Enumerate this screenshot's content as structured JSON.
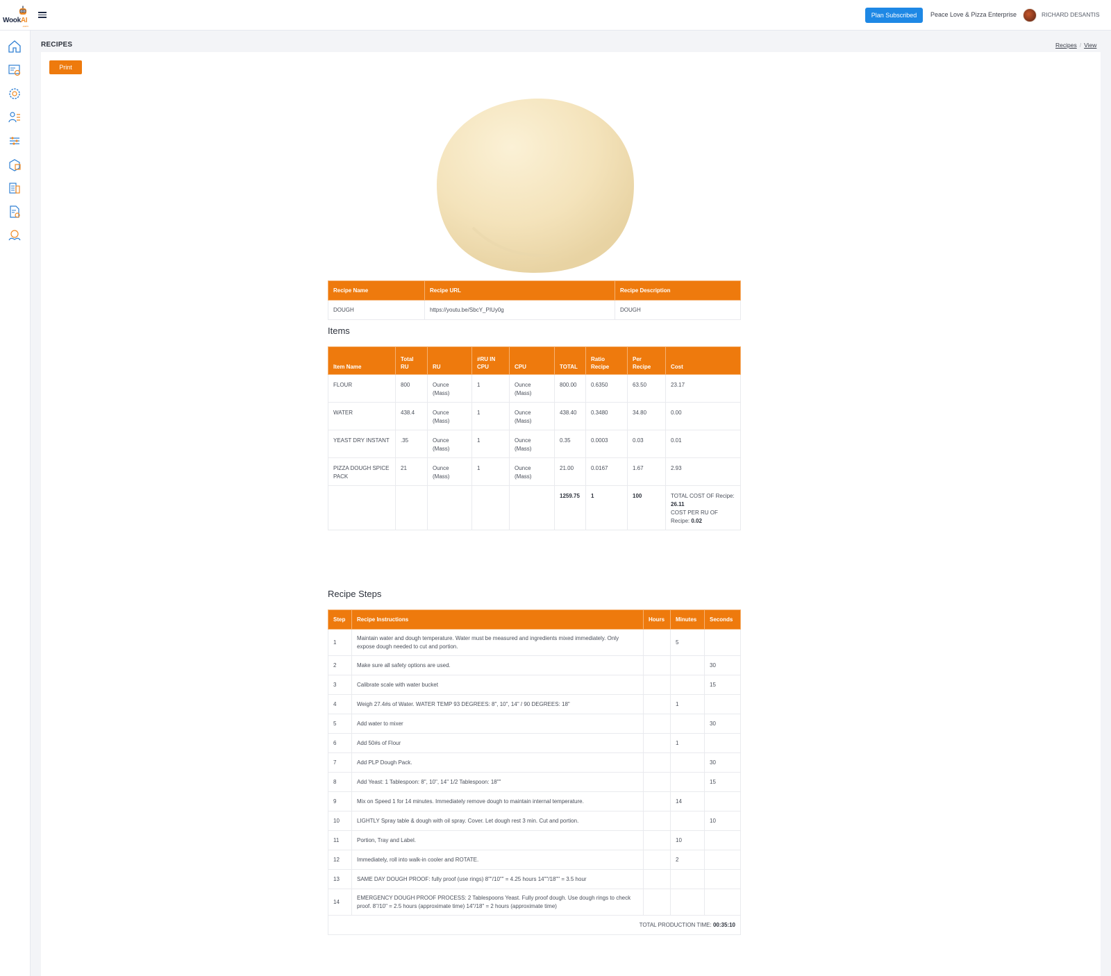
{
  "header": {
    "logo_text": "Wook",
    "logo_accent": "AI",
    "logo_sub": ".com",
    "plan_button": "Plan Subscribed",
    "company": "Peace Love & Pizza Enterprise",
    "user_name": "RICHARD DESANTIS",
    "caret": "⌄"
  },
  "page": {
    "title": "RECIPES",
    "breadcrumb": {
      "recipes": "Recipes",
      "sep": "/",
      "view": "View"
    },
    "print_button": "Print"
  },
  "recipe": {
    "headers": {
      "name": "Recipe Name",
      "url": "Recipe URL",
      "description": "Recipe Description"
    },
    "name": "DOUGH",
    "url": "https://youtu.be/SbcY_PIUy0g",
    "description": "DOUGH"
  },
  "items": {
    "title": "Items",
    "headers": {
      "item_name": "Item Name",
      "total_ru": "Total RU",
      "ru": "RU",
      "ru_in_cpu": "#RU IN CPU",
      "cpu": "CPU",
      "total": "TOTAL",
      "ratio": "Ratio Recipe",
      "per_recipe": "Per Recipe",
      "cost": "Cost"
    },
    "rows": [
      {
        "name": "FLOUR",
        "total_ru": "800",
        "ru": "Ounce (Mass)",
        "ru_in_cpu": "1",
        "cpu": "Ounce (Mass)",
        "total": "800.00",
        "ratio": "0.6350",
        "per_recipe": "63.50",
        "cost": "23.17"
      },
      {
        "name": "WATER",
        "total_ru": "438.4",
        "ru": "Ounce (Mass)",
        "ru_in_cpu": "1",
        "cpu": "Ounce (Mass)",
        "total": "438.40",
        "ratio": "0.3480",
        "per_recipe": "34.80",
        "cost": "0.00"
      },
      {
        "name": "YEAST DRY INSTANT",
        "total_ru": ".35",
        "ru": "Ounce (Mass)",
        "ru_in_cpu": "1",
        "cpu": "Ounce (Mass)",
        "total": "0.35",
        "ratio": "0.0003",
        "per_recipe": "0.03",
        "cost": "0.01"
      },
      {
        "name": "PIZZA DOUGH SPICE PACK",
        "total_ru": "21",
        "ru": "Ounce (Mass)",
        "ru_in_cpu": "1",
        "cpu": "Ounce (Mass)",
        "total": "21.00",
        "ratio": "0.0167",
        "per_recipe": "1.67",
        "cost": "2.93"
      }
    ],
    "totals": {
      "total": "1259.75",
      "ratio": "1",
      "per_recipe": "100",
      "cost_label": "TOTAL COST OF Recipe:",
      "cost_value": "26.11",
      "per_ru_label": "COST PER RU OF Recipe:",
      "per_ru_value": "0.02"
    }
  },
  "steps": {
    "title": "Recipe Steps",
    "headers": {
      "step": "Step",
      "instructions": "Recipe Instructions",
      "hours": "Hours",
      "minutes": "Minutes",
      "seconds": "Seconds"
    },
    "rows": [
      {
        "step": "1",
        "text": "Maintain water and dough temperature. Water must be measured and ingredients mixed immediately. Only expose dough needed to cut and portion.",
        "hours": "",
        "minutes": "5",
        "seconds": ""
      },
      {
        "step": "2",
        "text": "Make sure all safety options are used.",
        "hours": "",
        "minutes": "",
        "seconds": "30"
      },
      {
        "step": "3",
        "text": "Calibrate scale with water bucket",
        "hours": "",
        "minutes": "",
        "seconds": "15"
      },
      {
        "step": "4",
        "text": "Weigh 27.4#s of Water. WATER TEMP 93 DEGREES: 8\", 10\", 14\" / 90 DEGREES: 18\"",
        "hours": "",
        "minutes": "1",
        "seconds": ""
      },
      {
        "step": "5",
        "text": "Add water to mixer",
        "hours": "",
        "minutes": "",
        "seconds": "30"
      },
      {
        "step": "6",
        "text": "Add 50#s of Flour",
        "hours": "",
        "minutes": "1",
        "seconds": ""
      },
      {
        "step": "7",
        "text": "Add PLP Dough Pack.",
        "hours": "",
        "minutes": "",
        "seconds": "30"
      },
      {
        "step": "8",
        "text": "Add Yeast: 1 Tablespoon: 8\", 10\", 14\" 1/2 Tablespoon: 18\"\"",
        "hours": "",
        "minutes": "",
        "seconds": "15"
      },
      {
        "step": "9",
        "text": "Mix on Speed 1 for 14 minutes. Immediately remove dough to maintain internal temperature.",
        "hours": "",
        "minutes": "14",
        "seconds": ""
      },
      {
        "step": "10",
        "text": "LIGHTLY Spray table & dough with oil spray. Cover. Let dough rest 3 min. Cut and portion.",
        "hours": "",
        "minutes": "",
        "seconds": "10"
      },
      {
        "step": "11",
        "text": "Portion, Tray and Label.",
        "hours": "",
        "minutes": "10",
        "seconds": ""
      },
      {
        "step": "12",
        "text": "Immediately, roll into walk-in cooler and ROTATE.",
        "hours": "",
        "minutes": "2",
        "seconds": ""
      },
      {
        "step": "13",
        "text": "SAME DAY DOUGH PROOF: fully proof (use rings) 8\"\"/10\"\" = 4.25 hours 14\"\"/18\"\" = 3.5 hour",
        "hours": "",
        "minutes": "",
        "seconds": ""
      },
      {
        "step": "14",
        "text": "EMERGENCY DOUGH PROOF PROCESS: 2 Tablespoons Yeast. Fully proof dough. Use dough rings to check proof. 8\"/10\" = 2.5 hours (approximate time) 14\"/18\" = 2 hours (approximate time)",
        "hours": "",
        "minutes": "",
        "seconds": ""
      }
    ],
    "total_label": "TOTAL PRODUCTION TIME:",
    "total_value": "00:35:10"
  },
  "colors": {
    "accent": "#ee7a0d",
    "primary": "#1e88e5",
    "icon_blue": "#2f7fd3",
    "icon_orange": "#f08a24"
  }
}
